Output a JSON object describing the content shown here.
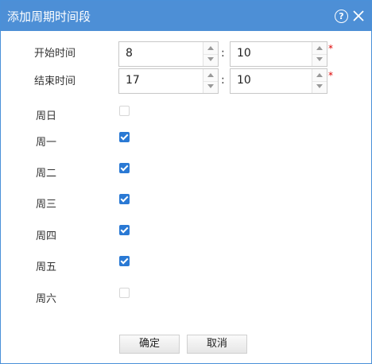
{
  "dialog": {
    "title": "添加周期时间段"
  },
  "start_time": {
    "label": "开始时间",
    "hour": "8",
    "minute": "10",
    "separator": ":",
    "required_mark": "*"
  },
  "end_time": {
    "label": "结束时间",
    "hour": "17",
    "minute": "10",
    "separator": ":",
    "required_mark": "*"
  },
  "days": [
    {
      "label": "周日",
      "checked": false
    },
    {
      "label": "周一",
      "checked": true
    },
    {
      "label": "周二",
      "checked": true
    },
    {
      "label": "周三",
      "checked": true
    },
    {
      "label": "周四",
      "checked": true
    },
    {
      "label": "周五",
      "checked": true
    },
    {
      "label": "周六",
      "checked": false
    }
  ],
  "buttons": {
    "ok": "确定",
    "cancel": "取消"
  },
  "colors": {
    "titlebar": "#4d8fd6",
    "checkbox_checked": "#2a79d4",
    "required": "#dd0000"
  }
}
